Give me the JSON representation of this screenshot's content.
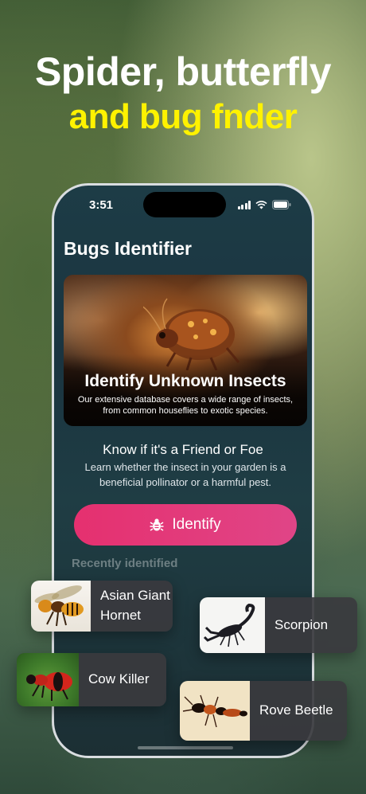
{
  "headline": {
    "line1": "Spider, butterfly",
    "line2": "and bug fnder"
  },
  "status_bar": {
    "time": "3:51"
  },
  "app": {
    "title": "Bugs Identifier",
    "hero": {
      "title": "Identify Unknown Insects",
      "text": "Our extensive database covers a wide range of insects, from common houseflies to exotic species."
    },
    "section": {
      "title": "Know if it's a Friend or Foe",
      "text": "Learn whether the insect in your garden is a beneficial pollinator or a harmful pest."
    },
    "identify_button": "Identify",
    "recent_label": "Recently identified"
  },
  "recent_cards": [
    {
      "name": "Asian Giant Hornet"
    },
    {
      "name": "Scorpion"
    },
    {
      "name": "Cow Killer"
    },
    {
      "name": "Rove Beetle"
    }
  ],
  "colors": {
    "headline_accent": "#fff200",
    "button_accent": "#e5306f"
  }
}
